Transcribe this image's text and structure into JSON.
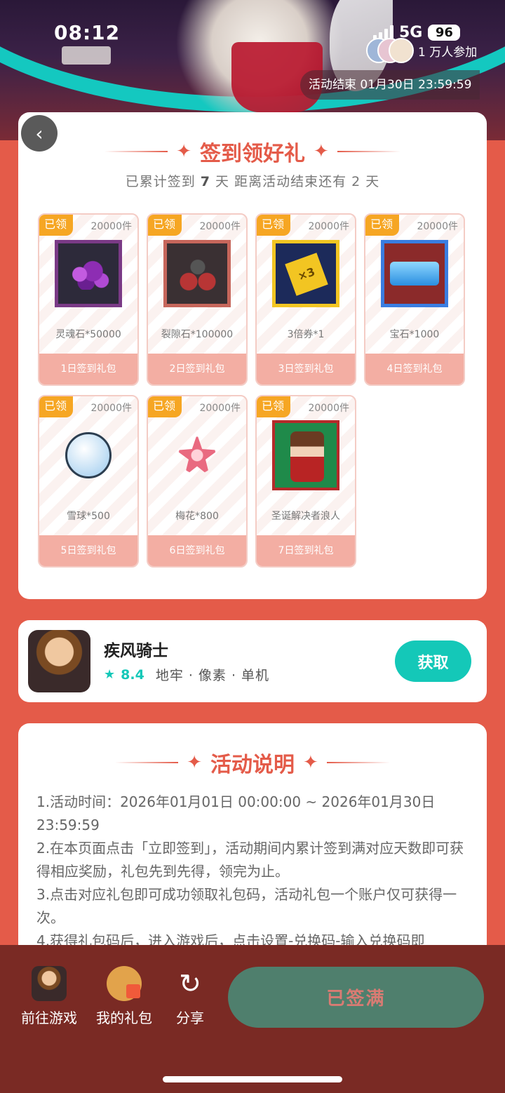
{
  "status_bar": {
    "time": "08:12",
    "network": "5G",
    "battery": "96"
  },
  "header": {
    "participants": "1 万人参加",
    "end_time": "活动结束 01月30日 23:59:59"
  },
  "signin": {
    "title": "签到领好礼",
    "subtitle_prefix": "已累计签到",
    "days_signed": "7",
    "subtitle_mid": "天  距离活动结束还有",
    "days_left": "2",
    "subtitle_suffix": "天",
    "gifts": [
      {
        "tag": "已领",
        "stock": "20000件",
        "name": "灵魂石*50000",
        "label": "1日签到礼包",
        "icon": "soul-stone-icon"
      },
      {
        "tag": "已领",
        "stock": "20000件",
        "name": "裂隙石*100000",
        "label": "2日签到礼包",
        "icon": "rift-stone-icon"
      },
      {
        "tag": "已领",
        "stock": "20000件",
        "name": "3倍券*1",
        "label": "3日签到礼包",
        "icon": "triple-ticket-icon"
      },
      {
        "tag": "已领",
        "stock": "20000件",
        "name": "宝石*1000",
        "label": "4日签到礼包",
        "icon": "gem-icon"
      },
      {
        "tag": "已领",
        "stock": "20000件",
        "name": "雪球*500",
        "label": "5日签到礼包",
        "icon": "snowball-icon"
      },
      {
        "tag": "已领",
        "stock": "20000件",
        "name": "梅花*800",
        "label": "6日签到礼包",
        "icon": "plum-blossom-icon"
      },
      {
        "tag": "已领",
        "stock": "20000件",
        "name": "圣诞解决者浪人",
        "label": "7日签到礼包",
        "icon": "christmas-ronin-icon"
      }
    ]
  },
  "game": {
    "name": "疾风骑士",
    "rating": "8.4",
    "tags": "地牢 · 像素 · 单机",
    "get_label": "获取"
  },
  "rules": {
    "title": "活动说明",
    "lines": [
      "1.活动时间：2026年01月01日 00:00:00 ~ 2026年01月30日 23:59:59",
      "2.在本页面点击「立即签到」，活动期间内累计签到满对应天数即可获得相应奖励，礼包先到先得，领完为止。",
      "3.点击对应礼包即可成功领取礼包码，活动礼包一个账户仅可获得一次。",
      "4.获得礼包码后，进入游戏后，点击设置-兑换码-输入兑换码即"
    ]
  },
  "bottom_bar": {
    "go_game": "前往游戏",
    "my_gifts": "我的礼包",
    "share": "分享",
    "signed_full": "已签满"
  },
  "colors": {
    "accent": "#e45b49",
    "teal": "#14c8b8",
    "tag": "#f6a623",
    "bottom": "#7a2a24"
  }
}
